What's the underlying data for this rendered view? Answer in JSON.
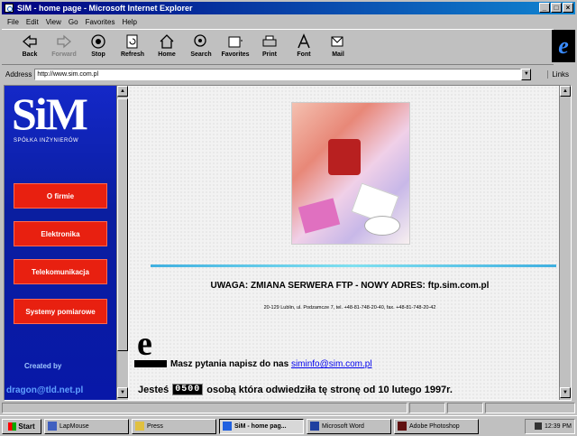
{
  "window": {
    "title": "SIM - home page - Microsoft Internet Explorer"
  },
  "menu": [
    "File",
    "Edit",
    "View",
    "Go",
    "Favorites",
    "Help"
  ],
  "toolbar": [
    {
      "label": "Back",
      "icon": "back-arrow-icon",
      "enabled": true
    },
    {
      "label": "Forward",
      "icon": "forward-arrow-icon",
      "enabled": false
    },
    {
      "label": "Stop",
      "icon": "stop-icon",
      "enabled": true
    },
    {
      "label": "Refresh",
      "icon": "refresh-icon",
      "enabled": true
    },
    {
      "label": "Home",
      "icon": "home-icon",
      "enabled": true
    },
    {
      "label": "Search",
      "icon": "search-icon",
      "enabled": true
    },
    {
      "label": "Favorites",
      "icon": "favorites-icon",
      "enabled": true
    },
    {
      "label": "Print",
      "icon": "print-icon",
      "enabled": true
    },
    {
      "label": "Font",
      "icon": "font-icon",
      "enabled": true
    },
    {
      "label": "Mail",
      "icon": "mail-icon",
      "enabled": true
    }
  ],
  "address": {
    "label": "Address",
    "value": "http://www.sim.com.pl",
    "links_label": "Links"
  },
  "left": {
    "logo": "SiM",
    "subtitle": "SPÓŁKA INŻYNIERÓW",
    "nav": [
      "O firmie",
      "Elektronika",
      "Telekomunikacja",
      "Systemy pomiarowe"
    ],
    "created_by": "Created by",
    "created_link": "dragon@tld.net.pl"
  },
  "main": {
    "notice": "UWAGA: ZMIANA SERWERA FTP - NOWY ADRES: ftp.sim.com.pl",
    "company_address": "20-129 Lublin, ul. Podzamcze 7, tel. +48-81-748-20-40, fax. +48-81-748-20-42",
    "question_text": "Masz pytania napisz do nas",
    "email": "siminfo@sim.com.pl",
    "counter_prefix": "Jesteś",
    "counter_value": "0500",
    "counter_suffix": "osobą która odwiedziła tę stronę od 10 lutego 1997r."
  },
  "taskbar": {
    "start": "Start",
    "tasks": [
      {
        "label": "LapMouse",
        "active": false
      },
      {
        "label": "Press",
        "active": false
      },
      {
        "label": "SiM - home pag...",
        "active": true
      },
      {
        "label": "Microsoft Word",
        "active": false
      },
      {
        "label": "Adobe Photoshop",
        "active": false
      }
    ],
    "clock": "12:39 PM"
  },
  "colors": {
    "title_bar": "#000080",
    "left_frame": "#1428c8",
    "nav_button": "#e82010",
    "divider": "#40b0e0",
    "link": "#0000ee"
  }
}
